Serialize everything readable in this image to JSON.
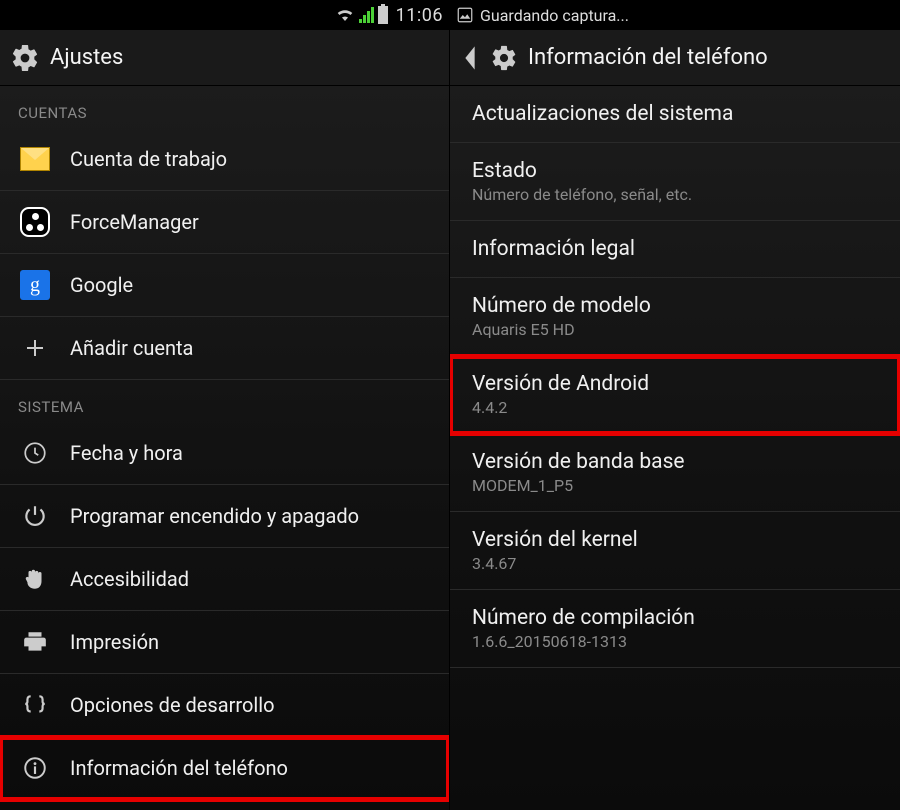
{
  "left": {
    "status": {
      "time": "11:06"
    },
    "title": "Ajustes",
    "sections": {
      "cuentas_header": "CUENTAS",
      "sistema_header": "SISTEMA"
    },
    "cuentas": {
      "trabajo": "Cuenta de trabajo",
      "forcemanager": "ForceManager",
      "google": "Google",
      "google_g": "g",
      "add": "Añadir cuenta"
    },
    "sistema": {
      "fecha": "Fecha y hora",
      "programar": "Programar encendido y apagado",
      "accesibilidad": "Accesibilidad",
      "impresion": "Impresión",
      "dev": "Opciones de desarrollo",
      "info": "Información del teléfono"
    }
  },
  "right": {
    "status_saving": "Guardando captura...",
    "title": "Información del teléfono",
    "items": {
      "update": {
        "label": "Actualizaciones del sistema"
      },
      "estado": {
        "label": "Estado",
        "sub": "Número de teléfono, señal, etc."
      },
      "legal": {
        "label": "Información legal"
      },
      "modelo": {
        "label": "Número de modelo",
        "sub": "Aquaris E5 HD"
      },
      "android": {
        "label": "Versión de Android",
        "sub": "4.4.2"
      },
      "baseband": {
        "label": "Versión de banda base",
        "sub": "MODEM_1_P5"
      },
      "kernel": {
        "label": "Versión del kernel",
        "sub": "3.4.67"
      },
      "build": {
        "label": "Número de compilación",
        "sub": "1.6.6_20150618-1313"
      }
    }
  }
}
